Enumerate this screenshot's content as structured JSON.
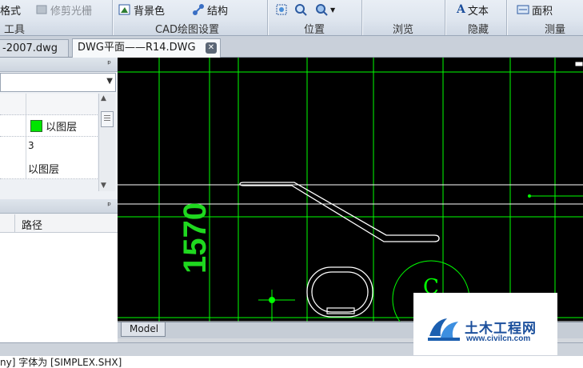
{
  "ribbon": {
    "buttons": {
      "format_partial": "格式",
      "trim_raster": "修剪光栅",
      "background_color": "背景色",
      "structure": "结构",
      "text": "文本",
      "area": "面积"
    },
    "groups": {
      "tools": "工具",
      "cad_settings": "CAD绘图设置",
      "position": "位置",
      "browse": "浏览",
      "hide": "隐藏",
      "measure": "测量"
    }
  },
  "tabs": [
    {
      "label": "-2007.dwg",
      "active": false
    },
    {
      "label": "DWG平面——R14.DWG",
      "active": true
    }
  ],
  "properties_panel": {
    "pin": "ᵖ",
    "combo_value": "",
    "rows": [
      {
        "value": ""
      },
      {
        "value": "以图层",
        "swatch_color": "#00e600"
      },
      {
        "value": "3"
      },
      {
        "value": "以图层"
      }
    ]
  },
  "layers_panel": {
    "pin": "ᵖ",
    "column_path": "路径"
  },
  "drawing": {
    "dimension_text": "1570",
    "circle_letter": "C",
    "line_color": "#00ff00",
    "outline_color": "#ffffff"
  },
  "model_tab": "Model",
  "command_line": "ny] 字体为 [SIMPLEX.SHX]",
  "watermark": {
    "title": "土木工程网",
    "url": "www.civilcn.com"
  }
}
